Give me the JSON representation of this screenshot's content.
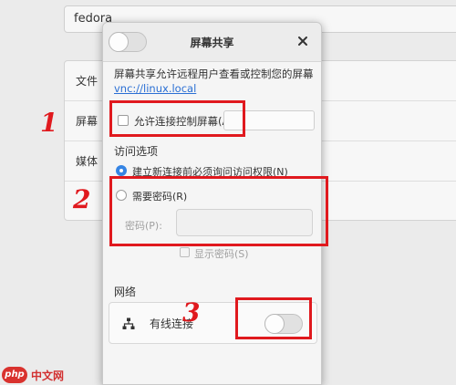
{
  "background": {
    "name_field_value": "fedora",
    "rows": [
      "文件",
      "屏幕",
      "媒体",
      ""
    ]
  },
  "dialog": {
    "title": "屏幕共享",
    "description": "屏幕共享允许远程用户查看或控制您的屏幕",
    "vnc_link": "vnc://linux.local",
    "allow_control_label": "允许连接控制屏幕(A)",
    "access_options_heading": "访问选项",
    "radio_new_connection": "建立新连接前必须询问访问权限(N)",
    "radio_require_password": "需要密码(R)",
    "password_label": "密码(P):",
    "show_password_label": "显示密码(S)",
    "network_heading": "网络",
    "network_item_label": "有线连接"
  },
  "annotations": [
    "1",
    "2",
    "3"
  ],
  "watermark": {
    "badge": "php",
    "text": "中文网"
  },
  "colors": {
    "accent": "#3584e4",
    "annotation": "#e0191e",
    "link": "#2a6fd4"
  }
}
